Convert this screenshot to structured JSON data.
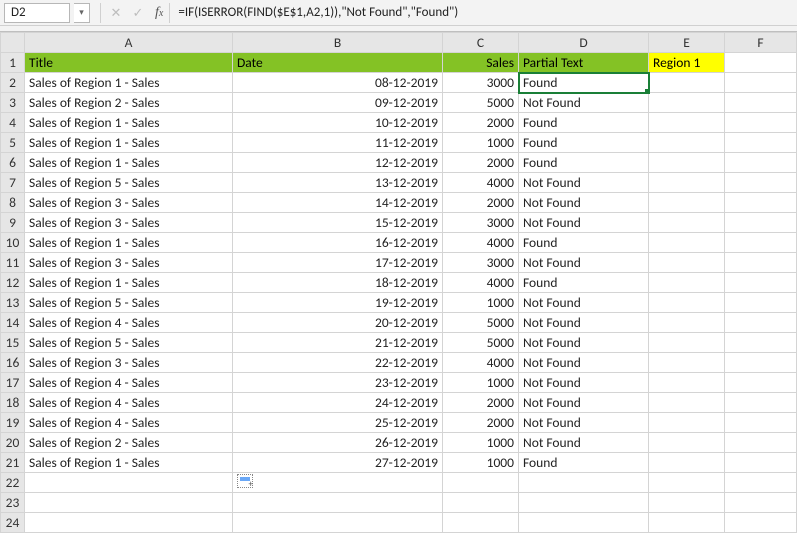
{
  "namebox": {
    "value": "D2"
  },
  "formula_bar": {
    "formula": "=IF(ISERROR(FIND($E$1,A2,1)),\"Not Found\",\"Found\")"
  },
  "columns": [
    "A",
    "B",
    "C",
    "D",
    "E",
    "F"
  ],
  "header_row": {
    "A": "Title",
    "B": "Date",
    "C": "Sales",
    "D": "Partial Text",
    "E": "Region 1",
    "F": ""
  },
  "rows": [
    {
      "n": 2,
      "A": "Sales of Region 1 - Sales",
      "B": "08-12-2019",
      "C": "3000",
      "D": "Found"
    },
    {
      "n": 3,
      "A": "Sales of Region 2 - Sales",
      "B": "09-12-2019",
      "C": "5000",
      "D": "Not Found"
    },
    {
      "n": 4,
      "A": "Sales of Region 1 - Sales",
      "B": "10-12-2019",
      "C": "2000",
      "D": "Found"
    },
    {
      "n": 5,
      "A": "Sales of Region 1 - Sales",
      "B": "11-12-2019",
      "C": "1000",
      "D": "Found"
    },
    {
      "n": 6,
      "A": "Sales of Region 1 - Sales",
      "B": "12-12-2019",
      "C": "2000",
      "D": "Found"
    },
    {
      "n": 7,
      "A": "Sales of Region 5 - Sales",
      "B": "13-12-2019",
      "C": "4000",
      "D": "Not Found"
    },
    {
      "n": 8,
      "A": "Sales of Region 3 - Sales",
      "B": "14-12-2019",
      "C": "2000",
      "D": "Not Found"
    },
    {
      "n": 9,
      "A": "Sales of Region 3 - Sales",
      "B": "15-12-2019",
      "C": "3000",
      "D": "Not Found"
    },
    {
      "n": 10,
      "A": "Sales of Region 1 - Sales",
      "B": "16-12-2019",
      "C": "4000",
      "D": "Found"
    },
    {
      "n": 11,
      "A": "Sales of Region 3 - Sales",
      "B": "17-12-2019",
      "C": "3000",
      "D": "Not Found"
    },
    {
      "n": 12,
      "A": "Sales of Region 1 - Sales",
      "B": "18-12-2019",
      "C": "4000",
      "D": "Found"
    },
    {
      "n": 13,
      "A": "Sales of Region 5 - Sales",
      "B": "19-12-2019",
      "C": "1000",
      "D": "Not Found"
    },
    {
      "n": 14,
      "A": "Sales of Region 4 - Sales",
      "B": "20-12-2019",
      "C": "5000",
      "D": "Not Found"
    },
    {
      "n": 15,
      "A": "Sales of Region 5 - Sales",
      "B": "21-12-2019",
      "C": "5000",
      "D": "Not Found"
    },
    {
      "n": 16,
      "A": "Sales of Region 3 - Sales",
      "B": "22-12-2019",
      "C": "4000",
      "D": "Not Found"
    },
    {
      "n": 17,
      "A": "Sales of Region 4 - Sales",
      "B": "23-12-2019",
      "C": "1000",
      "D": "Not Found"
    },
    {
      "n": 18,
      "A": "Sales of Region 4 - Sales",
      "B": "24-12-2019",
      "C": "2000",
      "D": "Not Found"
    },
    {
      "n": 19,
      "A": "Sales of Region 4 - Sales",
      "B": "25-12-2019",
      "C": "2000",
      "D": "Not Found"
    },
    {
      "n": 20,
      "A": "Sales of Region 2 - Sales",
      "B": "26-12-2019",
      "C": "1000",
      "D": "Not Found"
    },
    {
      "n": 21,
      "A": "Sales of Region 1 - Sales",
      "B": "27-12-2019",
      "C": "1000",
      "D": "Found"
    }
  ],
  "empty_rows": [
    22,
    23,
    24
  ],
  "selected_cell": "D2"
}
